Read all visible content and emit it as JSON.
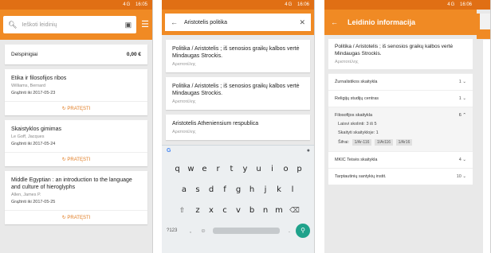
{
  "status": {
    "network": "4G",
    "time1": "16:05",
    "time2": "16:06",
    "time3": "16:06"
  },
  "screen1": {
    "search_placeholder": "Ieškoti leidinių",
    "debt": {
      "label": "Delspinigiai",
      "amount": "0,00 €"
    },
    "renew_label": "PRATĘSTI",
    "books": [
      {
        "title": "Etika ir filosofijos ribos",
        "author": "Williams, Bernard",
        "due": "Grąžinti iki 2017-05-23"
      },
      {
        "title": "Skaistyklos gimimas",
        "author": "Le Goff, Jacques",
        "due": "Grąžinti iki 2017-05-24"
      },
      {
        "title": "Middle Egyptian : an introduction to the language and culture of hieroglyphs",
        "author": "Allen, James P.",
        "due": "Grąžinti iki 2017-05-25"
      }
    ]
  },
  "screen2": {
    "query": "Aristotelis politika",
    "results": [
      {
        "title": "Politika / Aristotelis ; iš senosios graikų kalbos vertė Mindaugas Strockis.",
        "greek": "Αριστοτέλης"
      },
      {
        "title": "Politika / Aristotelis ; iš senosios graikų kalbos vertė Mindaugas Strockis.",
        "greek": "Αριστοτέλης"
      },
      {
        "title": "Aristotelis Atheniensium respublica",
        "greek": "Αριστοτέλης"
      }
    ],
    "keyboard": {
      "row1": [
        "q",
        "w",
        "e",
        "r",
        "t",
        "y",
        "u",
        "i",
        "o",
        "p"
      ],
      "row1_nums": [
        "1",
        "2",
        "3",
        "4",
        "5",
        "6",
        "7",
        "8",
        "9",
        "0"
      ],
      "row2": [
        "a",
        "s",
        "d",
        "f",
        "g",
        "h",
        "j",
        "k",
        "l"
      ],
      "row3": [
        "z",
        "x",
        "c",
        "v",
        "b",
        "n",
        "m"
      ],
      "key_123": "?123",
      "key_comma": ",",
      "key_period": "."
    }
  },
  "screen3": {
    "title": "Leidinio informacija",
    "record": {
      "title": "Politika / Aristotelis ; iš senosios graikų kalbos vertė Mindaugas Strockis.",
      "greek": "Αριστοτέλης"
    },
    "holdings": [
      {
        "name": "Žurnalistikos skaitykla",
        "count": "1"
      },
      {
        "name": "Religijų studijų centras",
        "count": "1"
      }
    ],
    "expanded": {
      "name": "Filosofijos skaitykla",
      "count": "6",
      "free": "Laisvi skolinti: 3 iš 5",
      "reading": "Skaityti skaitykloje: 1",
      "codes_label": "Šifrai:",
      "codes": [
        "1/Ar-116",
        "1/Ar116",
        "1/Ar16"
      ]
    },
    "holdings2": [
      {
        "name": "MKIC Teisės skaitykla",
        "count": "4"
      },
      {
        "name": "Tarptautinių santykių instit.",
        "count": "10"
      }
    ]
  }
}
